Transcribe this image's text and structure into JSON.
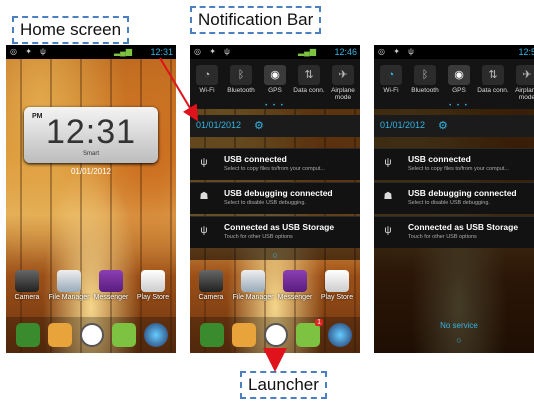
{
  "callouts": {
    "home": "Home screen",
    "notification": "Notification Bar",
    "launcher": "Launcher"
  },
  "home": {
    "status_time": "12:31",
    "clock": {
      "ampm": "PM",
      "time": "12:31",
      "brand": "Smart",
      "date": "01/01/2012"
    },
    "apps": [
      "Camera",
      "File Manager",
      "Messenger",
      "Play Store"
    ],
    "dock": [
      "phone-icon",
      "contacts-icon",
      "launcher-icon",
      "messaging-icon",
      "browser-icon"
    ]
  },
  "notifications_screen": {
    "status_time": "12:46",
    "quick_settings": [
      "Wi-Fi",
      "Bluetooth",
      "GPS",
      "Data conn.",
      "Airplane mode"
    ],
    "date": "01/01/2012",
    "items": [
      {
        "title": "USB connected",
        "subtitle": "Select to copy files to/from your comput...",
        "icon": "usb-icon"
      },
      {
        "title": "USB debugging connected",
        "subtitle": "Select to disable USB debugging.",
        "icon": "android-debug-icon"
      },
      {
        "title": "Connected as USB Storage",
        "subtitle": "Touch for other USB options",
        "icon": "usb-icon"
      }
    ],
    "apps": [
      "Camera",
      "File Manager",
      "Messenger",
      "Play Store"
    ],
    "dock_badge": "1"
  },
  "third_screen": {
    "status_time": "12:56",
    "quick_settings": [
      "Wi-Fi",
      "Bluetooth",
      "GPS",
      "Data conn.",
      "Airplane mode"
    ],
    "date": "01/01/2012",
    "items": [
      {
        "title": "USB connected",
        "subtitle": "Select to copy files to/from your comput..."
      },
      {
        "title": "USB debugging connected",
        "subtitle": "Select to disable USB debugging."
      },
      {
        "title": "Connected as USB Storage",
        "subtitle": "Touch for other USB options"
      }
    ],
    "no_service": "No service"
  },
  "colors": {
    "callout_border": "#4a7fc1",
    "accent": "#34b5e5",
    "arrow": "#e0121b"
  }
}
